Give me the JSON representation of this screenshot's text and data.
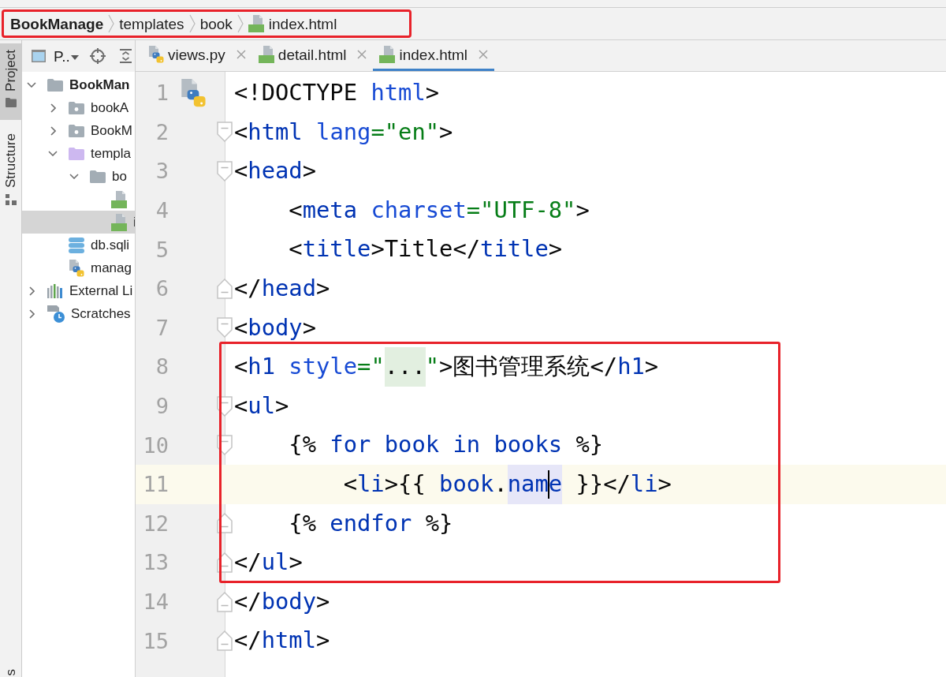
{
  "breadcrumb": {
    "annotated": true,
    "items": [
      {
        "label": "BookManage",
        "kind": "project"
      },
      {
        "label": "templates",
        "kind": "folder"
      },
      {
        "label": "book",
        "kind": "folder"
      },
      {
        "label": "index.html",
        "kind": "html"
      }
    ]
  },
  "tool_strip": {
    "top": [
      {
        "label": "Project",
        "kind": "project",
        "selected": true
      },
      {
        "label": "Structure",
        "kind": "structure",
        "selected": false
      }
    ],
    "bottom": [
      {
        "label": "s",
        "selected": false
      }
    ]
  },
  "project_panel": {
    "view_selector": "P..",
    "tree": [
      {
        "label": "BookMan",
        "kind": "project",
        "expanded": true,
        "selected": false,
        "children": [
          {
            "label": "bookA",
            "kind": "package",
            "expanded": false,
            "selected": false
          },
          {
            "label": "BookM",
            "kind": "package",
            "expanded": false,
            "selected": false
          },
          {
            "label": "templa",
            "kind": "templates",
            "expanded": true,
            "selected": false,
            "children": [
              {
                "label": "bo",
                "kind": "folder",
                "expanded": true,
                "selected": false,
                "children": [
                  {
                    "kind": "html",
                    "selected": false
                  },
                  {
                    "label": "i",
                    "kind": "html",
                    "selected": true
                  }
                ]
              }
            ]
          },
          {
            "label": "db.sqli",
            "kind": "database",
            "selected": false
          },
          {
            "label": "manag",
            "kind": "python",
            "selected": false
          }
        ]
      },
      {
        "label": "External Li",
        "kind": "libraries",
        "expanded": false,
        "selected": false
      },
      {
        "label": "Scratches",
        "kind": "scratches",
        "expanded": false,
        "selected": false
      }
    ]
  },
  "tabs": [
    {
      "label": "views.py",
      "kind": "python",
      "selected": false
    },
    {
      "label": "detail.html",
      "kind": "html",
      "selected": false
    },
    {
      "label": "index.html",
      "kind": "html",
      "selected": true
    }
  ],
  "editor": {
    "sections": [
      {
        "annotated": false,
        "lines": [
          {
            "number": "1",
            "gutter_icon": true,
            "current": false,
            "tokens": [
              {
                "text": "<!DOCTYPE",
                "kind": "punct"
              },
              {
                "text": " html",
                "kind": "attr"
              },
              {
                "text": ">",
                "kind": "punct"
              }
            ]
          },
          {
            "number": "2",
            "fold_open": true,
            "current": false,
            "tokens": [
              {
                "text": "<",
                "kind": "punct"
              },
              {
                "text": "html",
                "kind": "tag"
              },
              {
                "text": " lang",
                "kind": "attr"
              },
              {
                "text": "=\"en\"",
                "kind": "string"
              },
              {
                "text": ">",
                "kind": "punct"
              }
            ]
          },
          {
            "number": "3",
            "fold_open": true,
            "current": false,
            "tokens": [
              {
                "text": "<",
                "kind": "punct"
              },
              {
                "text": "head",
                "kind": "tag"
              },
              {
                "text": ">",
                "kind": "punct"
              }
            ]
          },
          {
            "number": "4",
            "current": false,
            "tokens": [
              {
                "text": "    <",
                "kind": "punct"
              },
              {
                "text": "meta",
                "kind": "tag"
              },
              {
                "text": " charset",
                "kind": "attr"
              },
              {
                "text": "=\"UTF-8\"",
                "kind": "string"
              },
              {
                "text": ">",
                "kind": "punct"
              }
            ]
          },
          {
            "number": "5",
            "current": false,
            "tokens": [
              {
                "text": "    <",
                "kind": "punct"
              },
              {
                "text": "title",
                "kind": "tag"
              },
              {
                "text": ">Title</",
                "kind": "punct"
              },
              {
                "text": "title",
                "kind": "tag"
              },
              {
                "text": ">",
                "kind": "punct"
              }
            ]
          },
          {
            "number": "6",
            "fold_close": true,
            "current": false,
            "tokens": [
              {
                "text": "</",
                "kind": "punct"
              },
              {
                "text": "head",
                "kind": "tag"
              },
              {
                "text": ">",
                "kind": "punct"
              }
            ]
          },
          {
            "number": "7",
            "fold_open": true,
            "current": false,
            "tokens": [
              {
                "text": "<",
                "kind": "punct"
              },
              {
                "text": "body",
                "kind": "tag"
              },
              {
                "text": ">",
                "kind": "punct"
              }
            ]
          }
        ]
      },
      {
        "annotated": true,
        "lines": [
          {
            "number": "8",
            "current": false,
            "tokens": [
              {
                "text": "<",
                "kind": "punct"
              },
              {
                "text": "h1",
                "kind": "tag"
              },
              {
                "text": " style",
                "kind": "attr"
              },
              {
                "text": "=\"",
                "kind": "string"
              },
              {
                "text": "...",
                "kind": "fold"
              },
              {
                "text": "\"",
                "kind": "string"
              },
              {
                "text": ">图书管理系统</",
                "kind": "punct"
              },
              {
                "text": "h1",
                "kind": "tag"
              },
              {
                "text": ">",
                "kind": "punct"
              }
            ]
          },
          {
            "number": "9",
            "fold_open": true,
            "current": false,
            "tokens": [
              {
                "text": "<",
                "kind": "punct"
              },
              {
                "text": "ul",
                "kind": "tag"
              },
              {
                "text": ">",
                "kind": "punct"
              }
            ]
          },
          {
            "number": "10",
            "fold_open": true,
            "current": false,
            "tokens": [
              {
                "text": "    {% ",
                "kind": "punct"
              },
              {
                "text": "for",
                "kind": "keyword"
              },
              {
                "text": " book",
                "kind": "keyword"
              },
              {
                "text": " in",
                "kind": "keyword"
              },
              {
                "text": " books",
                "kind": "keyword"
              },
              {
                "text": " %}",
                "kind": "punct"
              }
            ]
          },
          {
            "number": "11",
            "current": true,
            "tokens": [
              {
                "text": "        <",
                "kind": "punct"
              },
              {
                "text": "li",
                "kind": "tag"
              },
              {
                "text": ">{{ ",
                "kind": "punct"
              },
              {
                "text": "book",
                "kind": "keyword"
              },
              {
                "text": ".",
                "kind": "punct"
              },
              {
                "text": "nam",
                "kind": "occurrence"
              },
              {
                "kind": "caret"
              },
              {
                "text": "e",
                "kind": "occurrence"
              },
              {
                "text": " }}</",
                "kind": "punct"
              },
              {
                "text": "li",
                "kind": "tag"
              },
              {
                "text": ">",
                "kind": "punct"
              }
            ]
          },
          {
            "number": "12",
            "fold_close": true,
            "current": false,
            "tokens": [
              {
                "text": "    {% ",
                "kind": "punct"
              },
              {
                "text": "endfor",
                "kind": "keyword"
              },
              {
                "text": " %}",
                "kind": "punct"
              }
            ]
          },
          {
            "number": "13",
            "fold_close": true,
            "current": false,
            "tokens": [
              {
                "text": "</",
                "kind": "punct"
              },
              {
                "text": "ul",
                "kind": "tag"
              },
              {
                "text": ">",
                "kind": "punct"
              }
            ]
          }
        ]
      },
      {
        "annotated": false,
        "lines": [
          {
            "number": "14",
            "fold_close": true,
            "current": false,
            "tokens": [
              {
                "text": "</",
                "kind": "punct"
              },
              {
                "text": "body",
                "kind": "tag"
              },
              {
                "text": ">",
                "kind": "punct"
              }
            ]
          },
          {
            "number": "15",
            "fold_close": true,
            "current": false,
            "tokens": [
              {
                "text": "</",
                "kind": "punct"
              },
              {
                "text": "html",
                "kind": "tag"
              },
              {
                "text": ">",
                "kind": "punct"
              }
            ]
          }
        ]
      }
    ]
  }
}
